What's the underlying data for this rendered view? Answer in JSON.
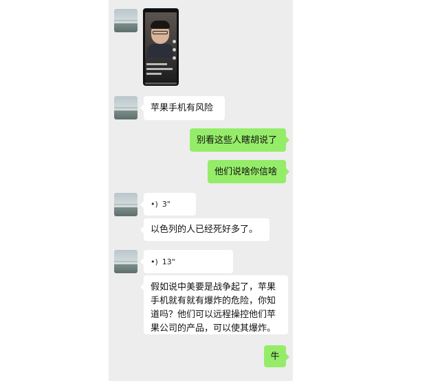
{
  "chat": {
    "messages": [
      {
        "id": "m1",
        "type": "video",
        "direction": "in"
      },
      {
        "id": "m2",
        "type": "text",
        "direction": "in",
        "text": "苹果手机有风险"
      },
      {
        "id": "m3",
        "type": "text",
        "direction": "out",
        "text": "别看这些人瞎胡说了"
      },
      {
        "id": "m4",
        "type": "text",
        "direction": "out",
        "text": "他们说啥你信啥"
      },
      {
        "id": "m5",
        "type": "voice",
        "direction": "in",
        "icon": "voice-wave-icon",
        "duration": "3\""
      },
      {
        "id": "m6",
        "type": "text",
        "direction": "in",
        "text": "以色列的人已经死好多了。"
      },
      {
        "id": "m7",
        "type": "voice",
        "direction": "in",
        "icon": "voice-wave-icon",
        "duration": "13\""
      },
      {
        "id": "m8",
        "type": "text",
        "direction": "in",
        "text": "假如说中美要是战争起了，苹果手机就有就有爆炸的危险，你知道吗？他们可以远程操控他们苹果公司的产品，可以使其爆炸。"
      },
      {
        "id": "m9",
        "type": "text",
        "direction": "out",
        "text": "牛"
      }
    ]
  },
  "colors": {
    "chat_background": "#ededed",
    "incoming_bubble": "#ffffff",
    "outgoing_bubble": "#95ec69"
  }
}
